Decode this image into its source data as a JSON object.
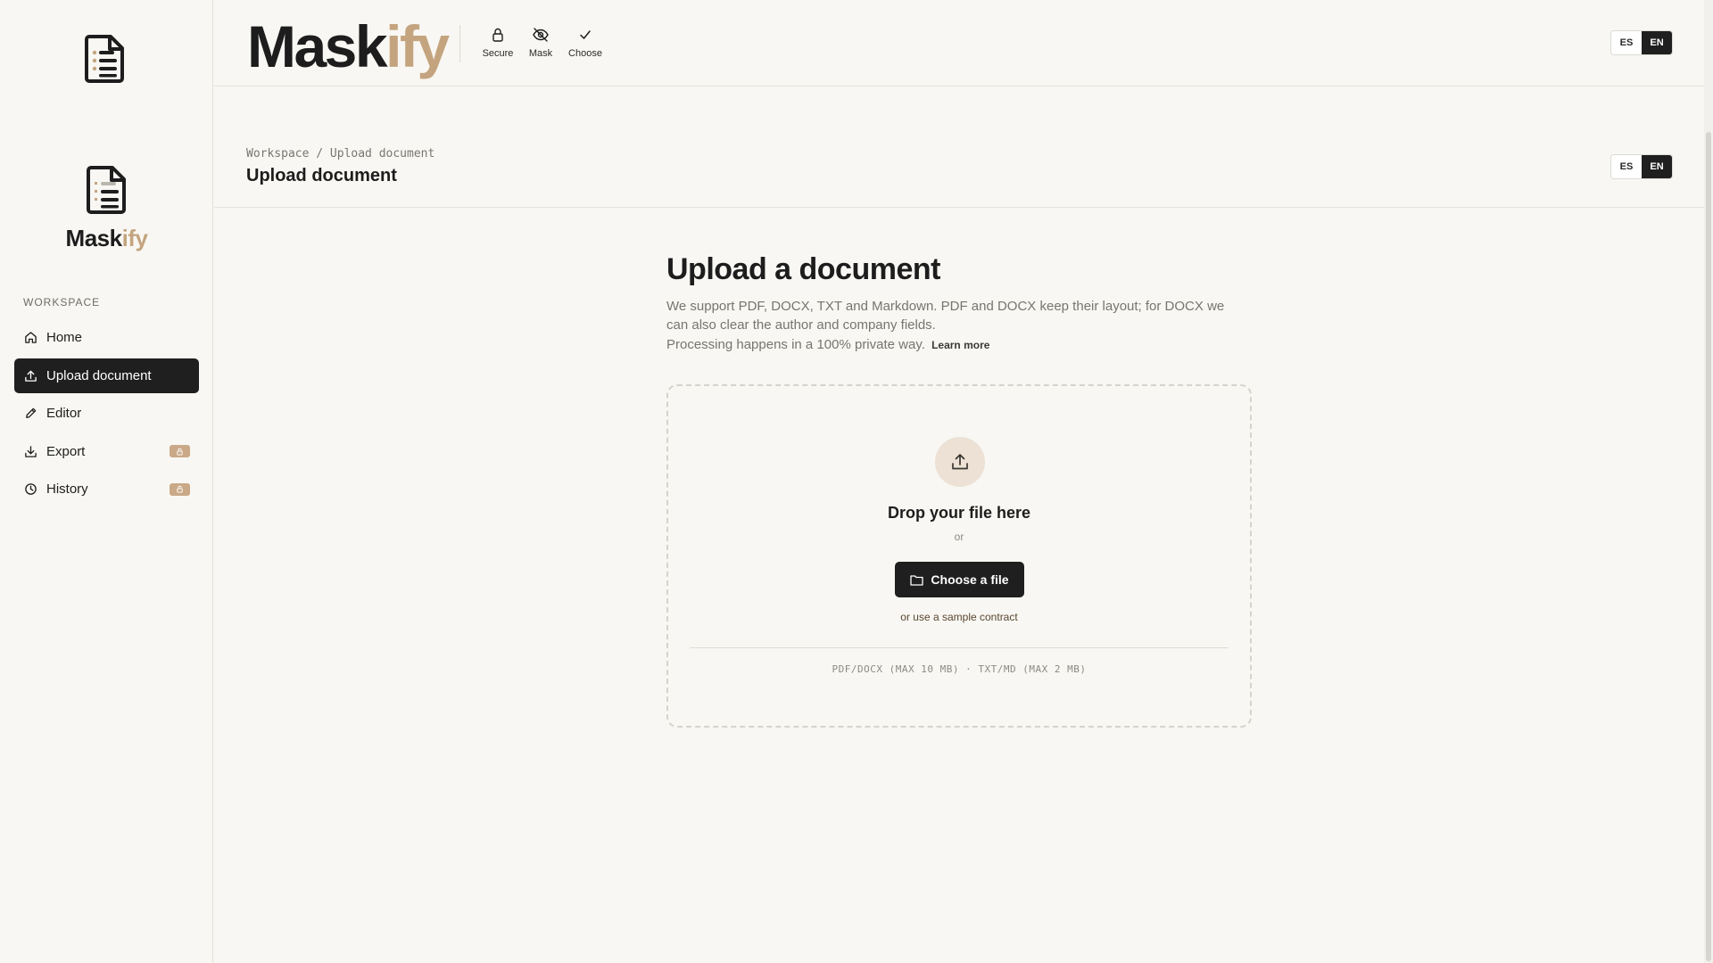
{
  "sidebar": {
    "brand_prefix": "Mask",
    "brand_suffix": "ify",
    "section_label": "WORKSPACE",
    "items": [
      {
        "label": "Home",
        "icon": "home-icon",
        "active": false,
        "locked": false
      },
      {
        "label": "Upload document",
        "icon": "upload-icon",
        "active": true,
        "locked": false
      },
      {
        "label": "Editor",
        "icon": "pencil-icon",
        "active": false,
        "locked": false
      },
      {
        "label": "Export",
        "icon": "download-icon",
        "active": false,
        "locked": true
      },
      {
        "label": "History",
        "icon": "clock-icon",
        "active": false,
        "locked": true
      }
    ]
  },
  "header": {
    "logo_prefix": "Mask",
    "logo_suffix": "ify",
    "features": [
      {
        "label": "Secure",
        "icon": "lock-icon"
      },
      {
        "label": "Mask",
        "icon": "eye-off-icon"
      },
      {
        "label": "Choose",
        "icon": "check-icon"
      }
    ],
    "lang": {
      "es": "ES",
      "en": "EN",
      "selected": "EN"
    }
  },
  "subheader": {
    "breadcrumb": "Workspace / Upload document",
    "title": "Upload document",
    "lang": {
      "es": "ES",
      "en": "EN",
      "selected": "EN"
    }
  },
  "main": {
    "heading": "Upload a document",
    "description": "We support PDF, DOCX, TXT and Markdown. PDF and DOCX keep their layout; for DOCX we can also clear the author and company fields.",
    "privacy": "Processing happens in a 100% private way.",
    "learn_more": "Learn more",
    "dropzone": {
      "title": "Drop your file here",
      "or": "or",
      "button": "Choose a file",
      "sample": "or use a sample contract",
      "limits": "PDF/DOCX (MAX 10 MB) · TXT/MD (MAX 2 MB)"
    }
  },
  "colors": {
    "accent": "#c4a47f",
    "dark": "#1f1f1f",
    "background": "#f8f7f3"
  }
}
